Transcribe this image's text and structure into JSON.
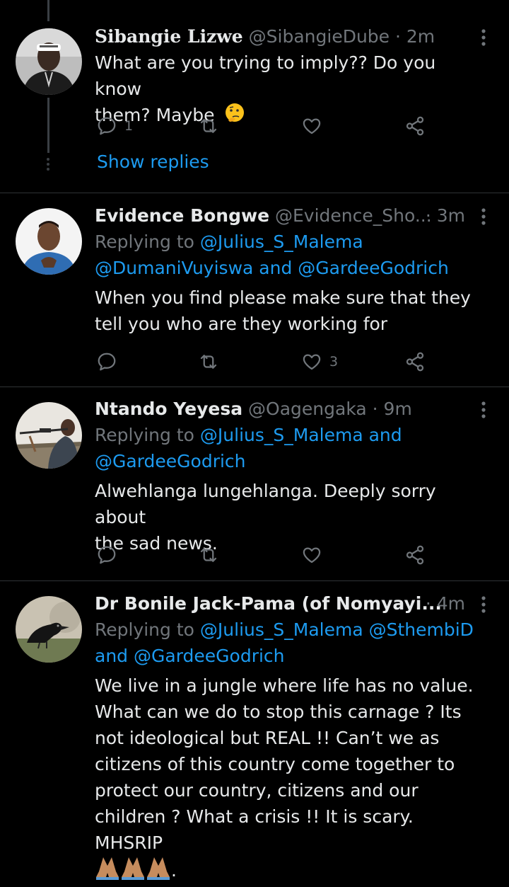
{
  "tweets": [
    {
      "name": "Sibangie Lizwe",
      "handle": "@SibangieDube",
      "time": "2m",
      "text_line1": "What are you trying to imply?? Do you know",
      "text_line2": "them? Maybe",
      "reply_count": "1",
      "like_count": "",
      "show_replies": "Show replies"
    },
    {
      "name": "Evidence Bongwe",
      "handle": "@Evidence_Sho...",
      "time": "3m",
      "replying_label": "Replying to",
      "mention1": "@Julius_S_Malema",
      "mention2": "@DumaniVuyiswa",
      "and_word": "and",
      "mention3": "@GardeeGodrich",
      "text_line1": "When you find please make sure that they",
      "text_line2": "tell you who are they working for",
      "like_count": "3"
    },
    {
      "name": "Ntando Yeyesa",
      "handle": "@Oagengaka",
      "time": "9m",
      "replying_label": "Replying to",
      "mention1": "@Julius_S_Malema",
      "and_word": "and",
      "mention2": "@GardeeGodrich",
      "text_line1": "Alwehlanga lungehlanga. Deeply sorry about",
      "text_line2": "the sad news."
    },
    {
      "name": "Dr Bonile Jack-Pama (of Nomyayi...",
      "time": "4m",
      "replying_label": "Replying to",
      "mention1": "@Julius_S_Malema",
      "mention2": "@SthembiD",
      "and_word": "and",
      "mention3": "@GardeeGodrich",
      "text_lines": [
        "We live in a jungle where life has no value.",
        "What can we do to stop this carnage ? Its",
        "not ideological but REAL !! Can’t we as",
        "citizens of this country come together to",
        "protect our country, citizens and our",
        "children ? What a crisis !! It is scary. MHSRIP"
      ],
      "trailing": "."
    }
  ],
  "dot_separator": "·",
  "colors": {
    "background": "#000000",
    "link": "#1d9bf0",
    "muted": "#71767b",
    "text": "#e7e9ea"
  }
}
